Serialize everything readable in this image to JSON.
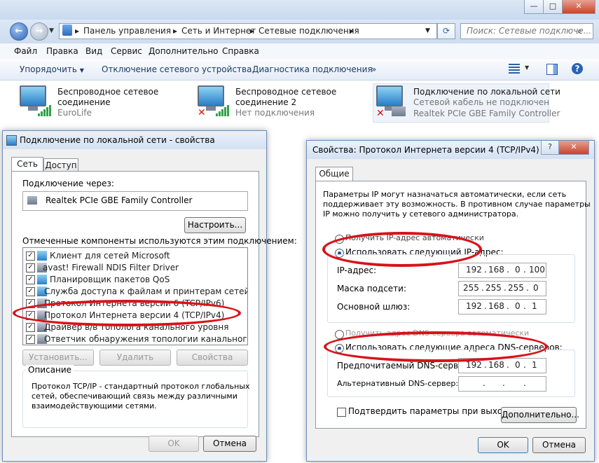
{
  "explorer": {
    "breadcrumb": [
      "Панель управления",
      "Сеть и Интернет",
      "Сетевые подключения"
    ],
    "search_placeholder": "Поиск: Сетевые подключе...",
    "menu": [
      "Файл",
      "Правка",
      "Вид",
      "Сервис",
      "Дополнительно",
      "Справка"
    ],
    "commands": [
      "Упорядочить",
      "Отключение сетевого устройства",
      "Диагностика подключения",
      "»"
    ],
    "connections": [
      {
        "title1": "Беспроводное сетевое",
        "title2": "соединение",
        "status": "EuroLife",
        "device": ""
      },
      {
        "title1": "Беспроводное сетевое",
        "title2": "соединение 2",
        "status": "Нет подключения",
        "device": ""
      },
      {
        "title1": "Подключение по локальной сети",
        "title2": "",
        "status": "Сетевой кабель не подключен",
        "device": "Realtek PCIe GBE Family Controller"
      }
    ]
  },
  "lan_dialog": {
    "title": "Подключение по локальной сети - свойства",
    "tabs": [
      "Сеть",
      "Доступ"
    ],
    "connect_using_label": "Подключение через:",
    "adapter": "Realtek PCIe GBE Family Controller",
    "configure": "Настроить...",
    "components_label": "Отмеченные компоненты используются этим подключением:",
    "components": [
      "Клиент для сетей Microsoft",
      "avast! Firewall NDIS Filter Driver",
      "Планировщик пакетов QoS",
      "Служба доступа к файлам и принтерам сетей Micro...",
      "Протокол Интернета версии 6 (TCP/IPv6)",
      "Протокол Интернета версии 4 (TCP/IPv4)",
      "Драйвер в/в тополога канального уровня",
      "Ответчик обнаружения топологии канального уровня"
    ],
    "install": "Установить...",
    "remove": "Удалить",
    "properties": "Свойства",
    "description_label": "Описание",
    "description": [
      "Протокол TCP/IP - стандартный протокол глобальных",
      "сетей, обеспечивающий связь между различными",
      "взаимодействующими сетями."
    ],
    "ok": "OK",
    "cancel": "Отмена"
  },
  "ipv4_dialog": {
    "title": "Свойства: Протокол Интернета версии 4 (TCP/IPv4)",
    "tab": "Общие",
    "info": [
      "Параметры IP могут назначаться автоматически, если сеть",
      "поддерживает эту возможность. В противном случае параметры",
      "IP можно получить у сетевого администратора."
    ],
    "auto_ip": "Получить IP-адрес автоматически",
    "manual_ip": "Использовать следующий IP-адрес:",
    "ip_label": "IP-адрес:",
    "ip": [
      "192",
      "168",
      "0",
      "100"
    ],
    "mask_label": "Маска подсети:",
    "mask": [
      "255",
      "255",
      "255",
      "0"
    ],
    "gateway_label": "Основной шлюз:",
    "gateway": [
      "192",
      "168",
      "0",
      "1"
    ],
    "auto_dns": "Получить адрес DNS-сервера автоматически",
    "manual_dns": "Использовать следующие адреса DNS-серверов:",
    "pref_dns_label": "Предпочитаемый DNS-сервер:",
    "pref_dns": [
      "192",
      "168",
      "0",
      "1"
    ],
    "alt_dns_label": "Альтернативный DNS-сервер:",
    "alt_dns": [
      "",
      "",
      "",
      ""
    ],
    "validate": "Подтвердить параметры при выходе",
    "advanced": "Дополнительно...",
    "ok": "OK",
    "cancel": "Отмена"
  }
}
